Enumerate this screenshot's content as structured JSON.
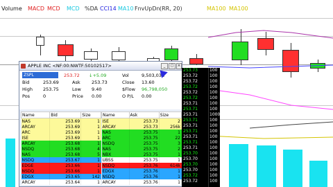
{
  "legend": [
    {
      "text": "Volume",
      "color": "#1a1a1a"
    },
    {
      "text": "MACD",
      "color": "#e02020"
    },
    {
      "text": "MCD",
      "color": "#e02020"
    },
    {
      "text": "MCD",
      "color": "#19c8e0"
    },
    {
      "text": "%DA",
      "color": "#333333"
    },
    {
      "text": "CCI14",
      "color": "#2020e0"
    },
    {
      "text": "MA10",
      "color": "#19c8e0"
    },
    {
      "text": "FnvUpDn",
      "color": "#333333"
    },
    {
      "text": "(RR, 20)",
      "color": "#333333"
    },
    {
      "text": "MA100",
      "color": "#d4c400"
    },
    {
      "text": "MA100",
      "color": "#d4c400"
    }
  ],
  "l2": {
    "title": "APPLE INC <NF:00:NWTF:50102517>",
    "symbol": "ZSPL",
    "last": "253.72",
    "change": "↓+5.09",
    "bid_label": "Bid",
    "bid": "253.69",
    "ask_label": "Ask",
    "ask": "253.73",
    "high_label": "High",
    "high": "253.75",
    "low_label": "Low",
    "low": "9.40",
    "pos_label": "Pos",
    "pos": "0",
    "price_label": "Price",
    "price": "0.00",
    "vol_label": "Vol",
    "vol": "9,503,036",
    "close_label": "Close",
    "close": "13.60",
    "flow_label": "$Flow",
    "flow": "96,798,050",
    "pl_label": "O P/L",
    "pl": "0.00",
    "bid_headers": [
      "Name",
      "Bid",
      "Size"
    ],
    "ask_headers": [
      "Name",
      "Ask",
      "Size"
    ],
    "bids": [
      {
        "name": "NAS",
        "price": "253.69",
        "size": "1",
        "bg": "#fdf99a"
      },
      {
        "name": "ARCAY",
        "price": "253.69",
        "size": "1",
        "bg": "#fdf99a"
      },
      {
        "name": "ARC",
        "price": "253.69",
        "size": "1",
        "bg": "#fdf99a"
      },
      {
        "name": "ISE",
        "price": "253.69",
        "size": "1",
        "bg": "#fdf99a"
      },
      {
        "name": "ARCAY",
        "price": "253.68",
        "size": "1",
        "bg": "#22dd22"
      },
      {
        "name": "NSDQ",
        "price": "253.68",
        "size": "4",
        "bg": "#22dd22"
      },
      {
        "name": "NAS",
        "price": "253.68",
        "size": "5",
        "bg": "#22dd22"
      },
      {
        "name": "NSDQ",
        "price": "253.67",
        "size": "1",
        "bg": "#2aa6ff"
      },
      {
        "name": "EDGE",
        "price": "253.66",
        "size": "1",
        "bg": "#ff1a1a"
      },
      {
        "name": "NSDQ",
        "price": "253.66",
        "size": "1",
        "bg": "#ff1a1a"
      },
      {
        "name": "EDGX",
        "price": "253.65",
        "size": "142",
        "bg": "#2aa6ff"
      },
      {
        "name": "ARCAY",
        "price": "253.64",
        "size": "1",
        "bg": "#ffffff"
      }
    ],
    "asks": [
      {
        "name": "ISE",
        "price": "253.73",
        "size": "2",
        "bg": "#fdf99a"
      },
      {
        "name": "ARCAY",
        "price": "253.73",
        "size": "256k",
        "bg": "#fdf99a"
      },
      {
        "name": "NAS",
        "price": "253.75",
        "size": "1",
        "bg": "#22dd22"
      },
      {
        "name": "ARC",
        "price": "253.75",
        "size": "22",
        "bg": "#22dd22"
      },
      {
        "name": "NSDQ",
        "price": "253.75",
        "size": "3",
        "bg": "#22dd22"
      },
      {
        "name": "NAS",
        "price": "253.75",
        "size": "2",
        "bg": "#22dd22"
      },
      {
        "name": "NBX",
        "price": "253.75",
        "size": "1",
        "bg": "#22dd22"
      },
      {
        "name": "UBSS",
        "price": "253.75",
        "size": "1",
        "bg": "#ffffff"
      },
      {
        "name": "NSDQ",
        "price": "253.76",
        "size": "614k",
        "bg": "#ff1a1a"
      },
      {
        "name": "EDGX",
        "price": "253.76",
        "size": "1",
        "bg": "#2aa6ff"
      },
      {
        "name": "NSDQ",
        "price": "253.76",
        "size": "1",
        "bg": "#2aa6ff"
      },
      {
        "name": "ARCAY",
        "price": "253.76",
        "size": "1",
        "bg": "#ffffff"
      }
    ]
  },
  "ts": [
    {
      "t": "253.73",
      "g": true
    },
    {
      "t": "253.72",
      "g": false
    },
    {
      "t": "253.72",
      "g": false
    },
    {
      "t": "253.72",
      "g": true
    },
    {
      "t": "253.72",
      "g": false
    },
    {
      "t": "253.72",
      "g": true
    },
    {
      "t": "253.71",
      "g": false
    },
    {
      "t": "253.71",
      "g": true
    },
    {
      "t": "253.71",
      "g": false
    },
    {
      "t": "253.71",
      "g": true
    },
    {
      "t": "253.71",
      "g": false
    },
    {
      "t": "253.71",
      "g": true
    },
    {
      "t": "253.71",
      "g": false
    },
    {
      "t": "253.71",
      "g": true
    },
    {
      "t": "253.71",
      "g": false
    },
    {
      "t": "253.70",
      "g": true
    },
    {
      "t": "253.70",
      "g": false
    },
    {
      "t": "253.70",
      "g": true
    },
    {
      "t": "253.70",
      "g": false
    },
    {
      "t": "253.72",
      "g": true
    },
    {
      "t": "253.72",
      "g": false
    }
  ],
  "ts_sizes": [
    "100",
    "100",
    "100",
    "100",
    "100",
    "100",
    "100",
    "100",
    "1000",
    "100",
    "100",
    "100",
    "100",
    "100",
    "100",
    "100",
    "100",
    "100",
    "100",
    "100",
    "100"
  ]
}
